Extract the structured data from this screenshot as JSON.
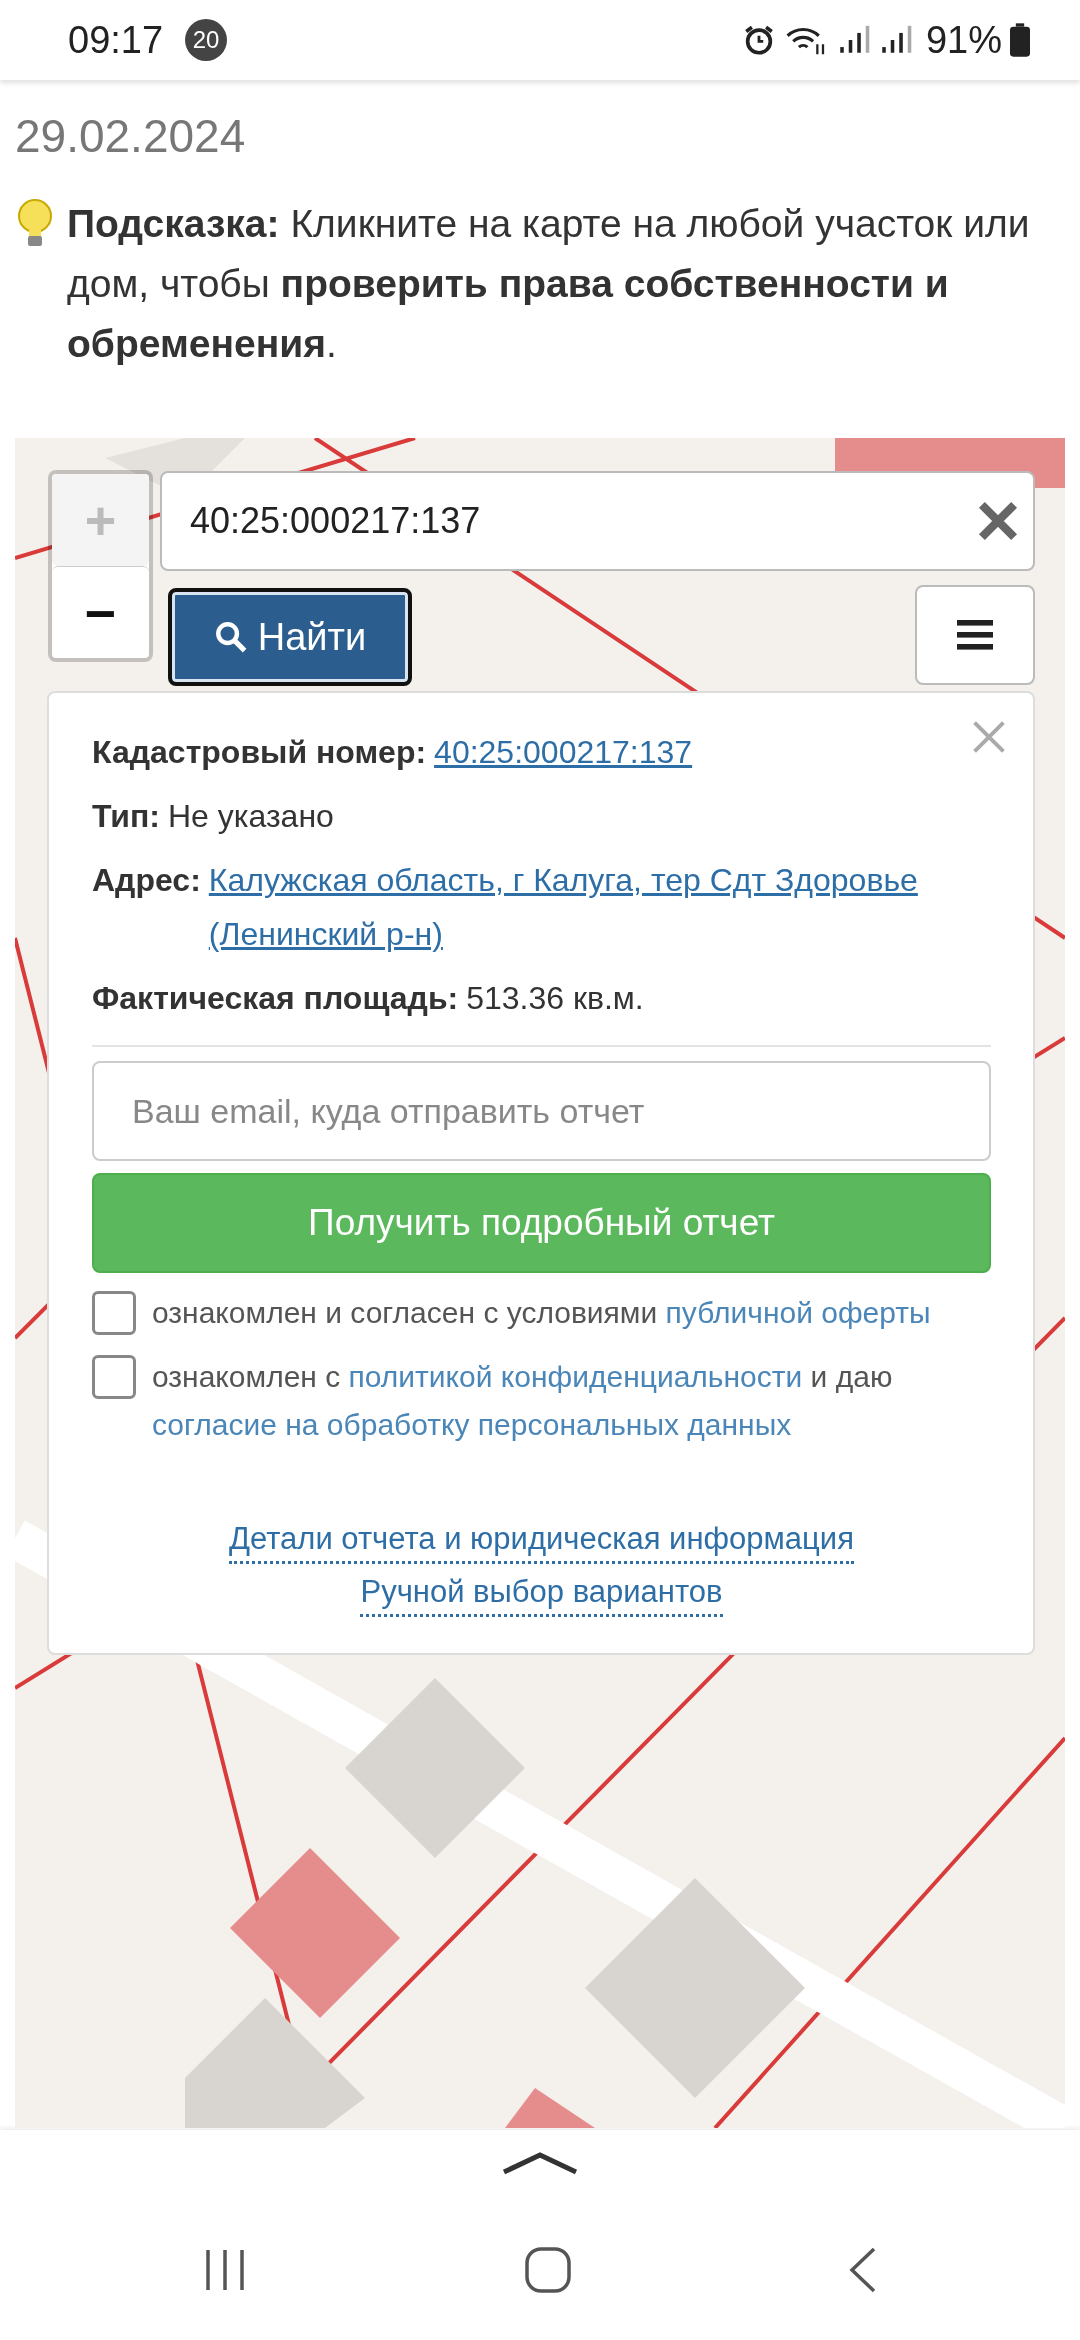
{
  "status_bar": {
    "time": "09:17",
    "notification_count": "20",
    "battery": "91%"
  },
  "date": "29.02.2024",
  "hint": "**Подсказка:** Кликните на карте на любой участок или дом, чтобы **проверить права собственности и обременения**.",
  "map": {
    "zoom": [
      {
        "label": "+",
        "disabled": true
      },
      {
        "label": "−",
        "disabled": false
      }
    ],
    "search": {
      "value": "40:25:000217:137"
    },
    "search_button": "Найти",
    "popup": {
      "fields": [
        {
          "label": "Кадастровый номер:",
          "value": "40:25:000217:137",
          "kind": "link"
        },
        {
          "label": "Тип:",
          "value": "Не указано",
          "kind": "text"
        },
        {
          "label": "Адрес:",
          "value": "Калужская область, г Калуга, тер Сдт Здоровье (Ленинский р-н)",
          "kind": "link"
        },
        {
          "label": "Фактическая площадь:",
          "value": "513.36 кв.м.",
          "kind": "text"
        }
      ],
      "email": {
        "placeholder": "Ваш email, куда отправить отчет"
      },
      "submit": "Получить подробный отчет",
      "agreements": [
        {
          "checked": false,
          "parts": [
            {
              "kind": "text",
              "text": "ознакомлен и согласен с условиями "
            },
            {
              "kind": "link",
              "text": "публичной оферты"
            }
          ]
        },
        {
          "checked": false,
          "parts": [
            {
              "kind": "text",
              "text": "ознакомлен с "
            },
            {
              "kind": "link",
              "text": "политикой конфиденциальности"
            },
            {
              "kind": "text",
              "text": " и даю "
            },
            {
              "kind": "link",
              "text": "согласие на обработку персональных данных"
            }
          ]
        }
      ],
      "links": [
        "Детали отчета и юридическая информация",
        "Ручной выбор вариантов"
      ]
    }
  }
}
